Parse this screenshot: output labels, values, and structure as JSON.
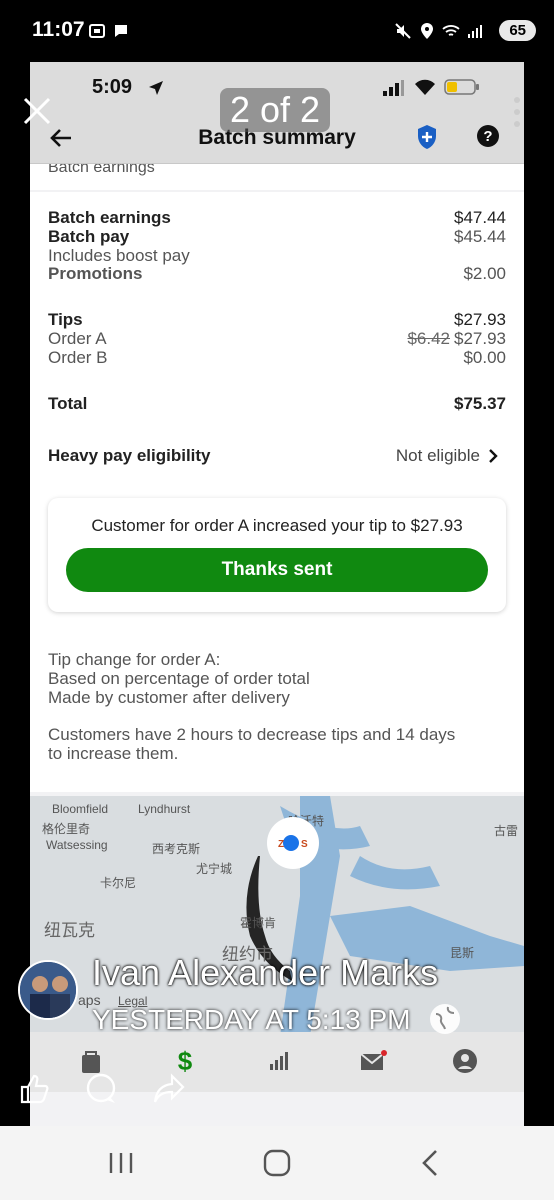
{
  "outer_status": {
    "time": "11:07",
    "battery": "65"
  },
  "inner_status": {
    "time": "5:09"
  },
  "nav": {
    "title": "Batch summary",
    "page_counter": "2 of 2"
  },
  "peek_text": "Batch earnings",
  "earnings": {
    "batch_earnings_label": "Batch earnings",
    "batch_earnings_value": "$47.44",
    "batch_pay_label": "Batch pay",
    "batch_pay_value": "$45.44",
    "boost_note": "Includes boost pay",
    "promotions_label": "Promotions",
    "promotions_value": "$2.00",
    "tips_label": "Tips",
    "tips_value": "$27.93",
    "order_a_label": "Order A",
    "order_a_old": "$6.42",
    "order_a_value": "$27.93",
    "order_b_label": "Order B",
    "order_b_value": "$0.00",
    "total_label": "Total",
    "total_value": "$75.37",
    "heavy_pay_label": "Heavy pay eligibility",
    "heavy_pay_value": "Not eligible"
  },
  "tip_notice": {
    "message": "Customer for order A increased your tip to $27.93",
    "button": "Thanks sent"
  },
  "info": {
    "line1": "Tip change for order A:",
    "line2": "Based on percentage of order total",
    "line3": "Made by customer after delivery",
    "line4": "Customers have 2 hours to decrease tips and 14 days",
    "line5": "to increase them."
  },
  "map": {
    "labels": [
      "Bloomfield",
      "Lyndhurst",
      "格伦里奇",
      "Watsessing",
      "西考克斯",
      "尤宁城",
      "卡尔尼",
      "纽瓦克",
      "霍博肯",
      "纽约市",
      "昆斯",
      "古雷",
      "aps",
      "Legal",
      "哈沃特"
    ]
  },
  "post": {
    "name": "Ivan Alexander Marks",
    "time": "YESTERDAY AT 5:13 PM"
  },
  "colors": {
    "accent_green": "#108910",
    "shield_blue": "#1a5fc4"
  }
}
